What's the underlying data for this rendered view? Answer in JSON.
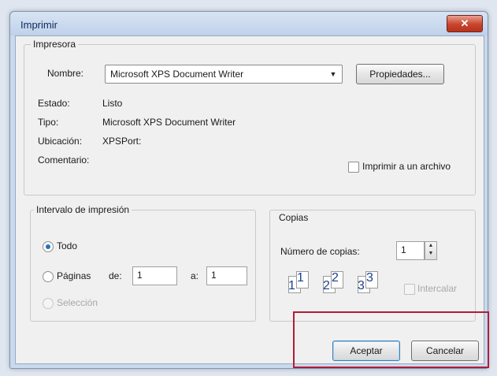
{
  "window": {
    "title": "Imprimir",
    "close_glyph": "✕"
  },
  "printer": {
    "group_label": "Impresora",
    "name_label": "Nombre:",
    "name_value": "Microsoft XPS Document Writer",
    "properties_button": "Propiedades...",
    "status_label": "Estado:",
    "status_value": "Listo",
    "type_label": "Tipo:",
    "type_value": "Microsoft XPS Document Writer",
    "location_label": "Ubicación:",
    "location_value": "XPSPort:",
    "comment_label": "Comentario:",
    "print_to_file_label": "Imprimir a un archivo"
  },
  "range": {
    "group_label": "Intervalo de impresión",
    "all_label": "Todo",
    "pages_label": "Páginas",
    "from_label": "de:",
    "from_value": "1",
    "to_label": "a:",
    "to_value": "1",
    "selection_label": "Selección"
  },
  "copies": {
    "group_label": "Copias",
    "number_label": "Número de copias:",
    "number_value": "1",
    "collate_label": "Intercalar",
    "collate_digits": [
      "1",
      "1",
      "2",
      "2",
      "3",
      "3"
    ]
  },
  "buttons": {
    "ok": "Aceptar",
    "cancel": "Cancelar"
  },
  "colors": {
    "accent": "#2b6fbf",
    "highlight": "#b21c38",
    "close": "#c9442c"
  }
}
